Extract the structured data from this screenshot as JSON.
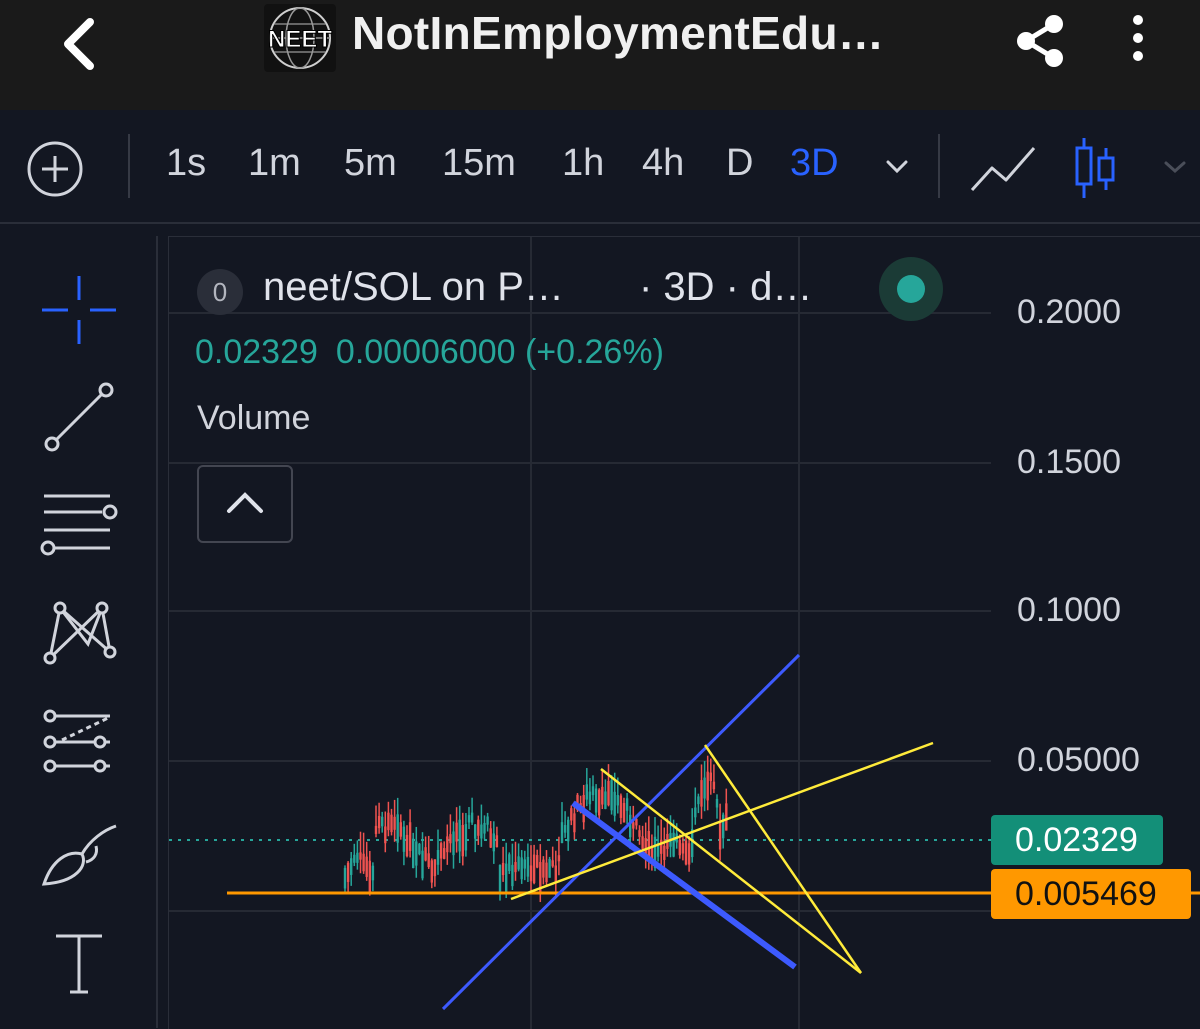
{
  "header": {
    "title": "NotInEmploymentEdu…",
    "logo_text": "NEET"
  },
  "toolbar": {
    "intervals": [
      "1s",
      "1m",
      "5m",
      "15m",
      "1h",
      "4h",
      "D",
      "3D"
    ],
    "active_interval": "3D"
  },
  "legend": {
    "badge": "0",
    "title": "neet/SOL on P…",
    "subtitle": "· 3D · d…",
    "price": "0.02329",
    "change": "0.00006000 (+0.26%)",
    "volume_label": "Volume"
  },
  "price_axis": {
    "labels": [
      "0.2000",
      "0.1500",
      "0.1000",
      "0.05000"
    ],
    "current_price": "0.02329",
    "marked_level": "0.005469"
  },
  "colors": {
    "up": "#26a69a",
    "down": "#ef5350",
    "accent": "#2962ff",
    "trend_blue": "#3d5afe",
    "trend_yellow": "#ffeb3b",
    "level_orange": "#ff9800"
  }
}
